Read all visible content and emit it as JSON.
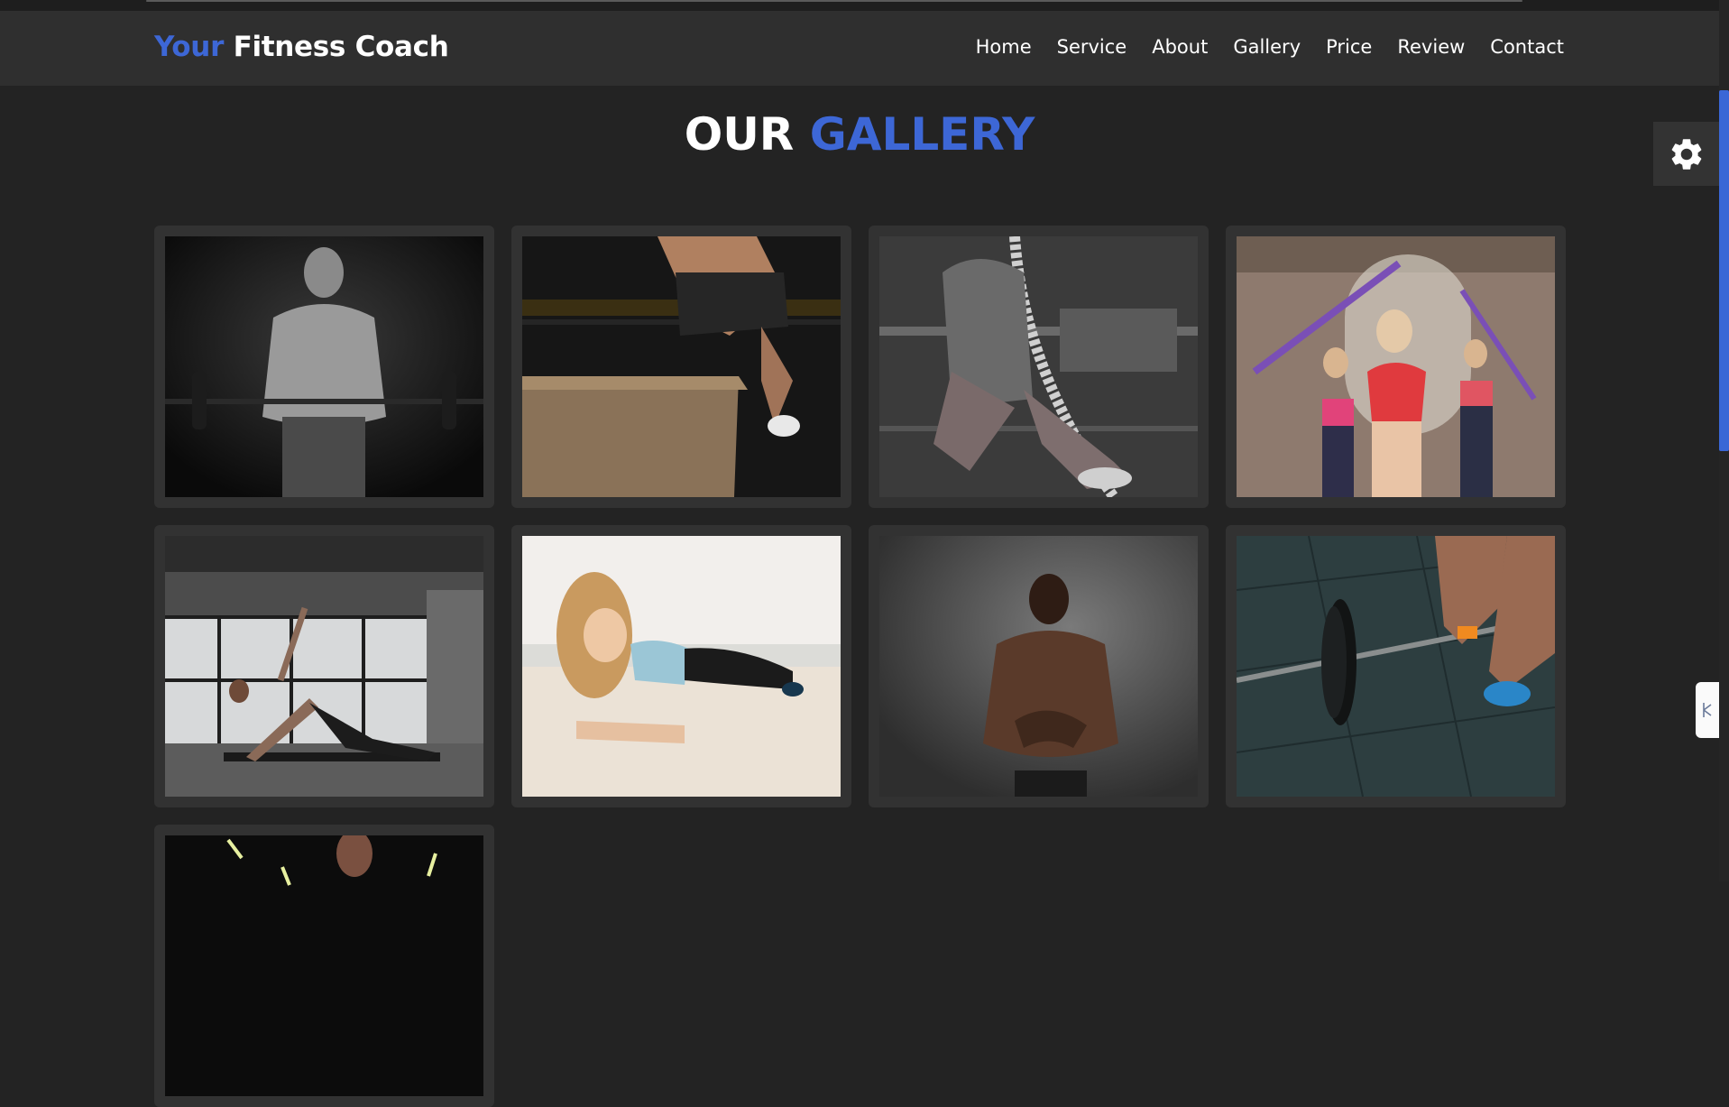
{
  "header": {
    "logo_accent": "Your",
    "logo_rest": "Fitness Coach",
    "nav": [
      "Home",
      "Service",
      "About",
      "Gallery",
      "Price",
      "Review",
      "Contact"
    ]
  },
  "section": {
    "title_part1": "OUR",
    "title_part2": "GALLERY"
  },
  "colors": {
    "accent": "#3d67d6",
    "background": "#232323",
    "header_bg": "#2f2f2f",
    "card_bg": "#323232"
  },
  "icons": {
    "settings": "gear-icon",
    "side_tab": "panel-handle-icon"
  },
  "gallery": [
    "gallery-image-barbell-curl",
    "gallery-image-box-jump",
    "gallery-image-rope-climb",
    "gallery-image-resistance-bands",
    "gallery-image-side-plank",
    "gallery-image-beach-plank",
    "gallery-image-muscle-pose",
    "gallery-image-barbell-lift",
    "gallery-image-gym-partial"
  ]
}
